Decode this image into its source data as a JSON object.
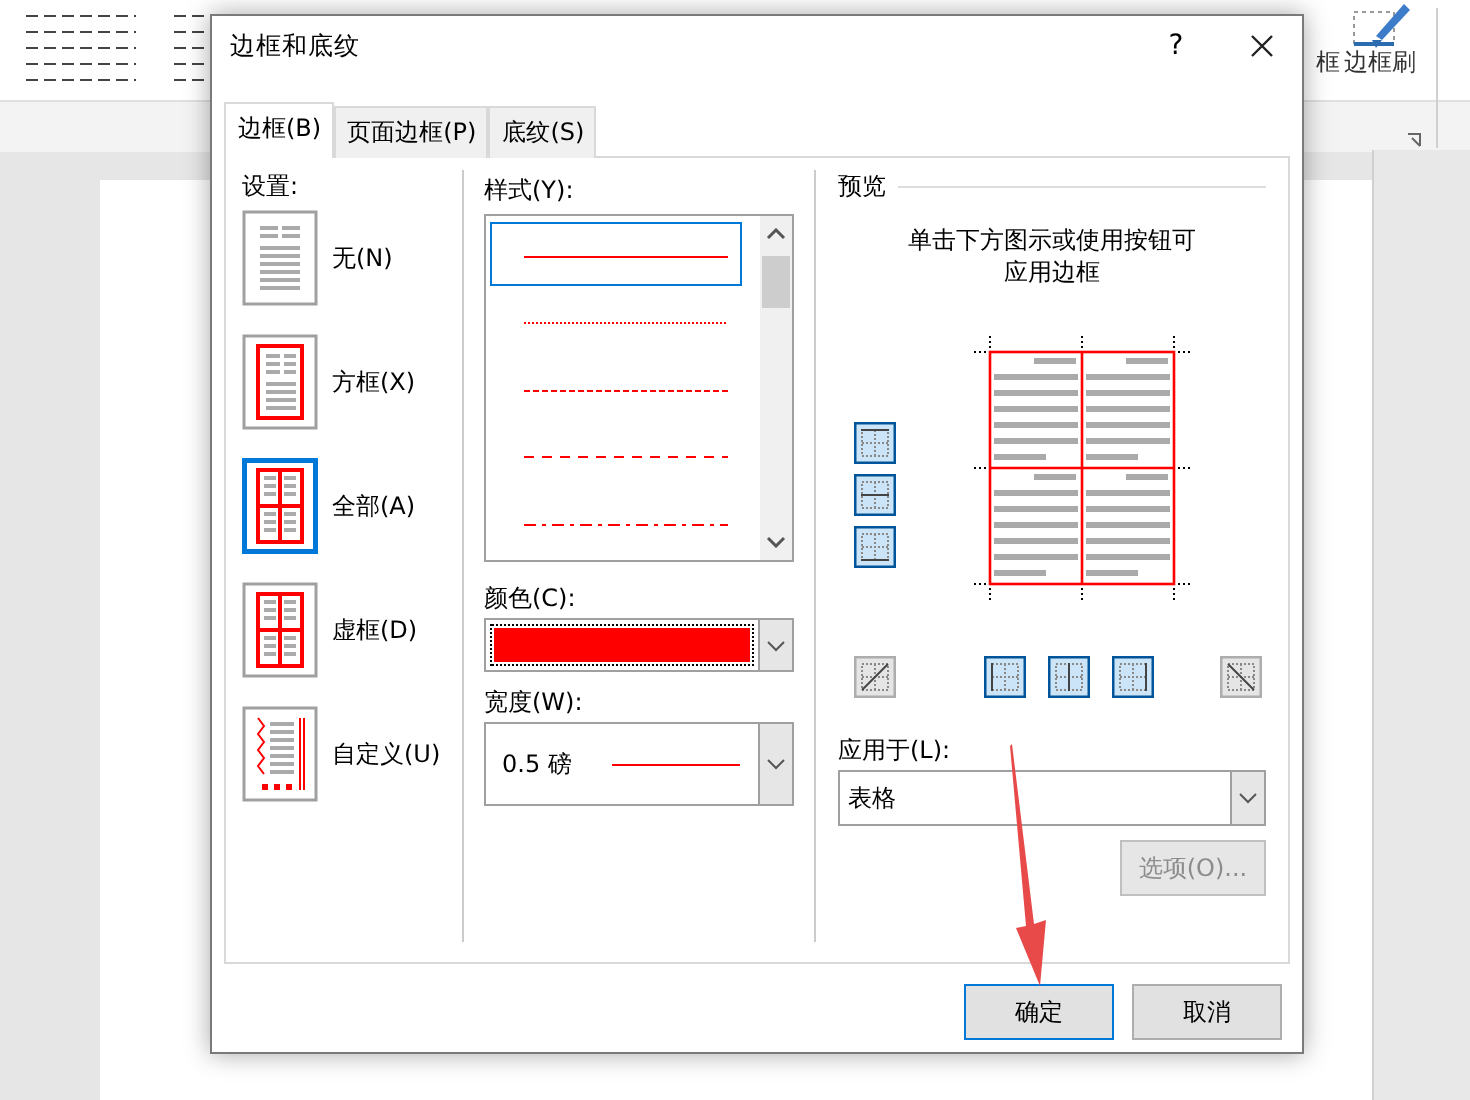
{
  "ribbon": {
    "labels": [
      {
        "text": "框"
      },
      {
        "text": "边框刷"
      }
    ]
  },
  "dialog": {
    "title": "边框和底纹",
    "help": "?"
  },
  "tabs": [
    {
      "label": "边框(B)",
      "selected": true
    },
    {
      "label": "页面边框(P)",
      "selected": false
    },
    {
      "label": "底纹(S)",
      "selected": false
    }
  ],
  "settings": {
    "label": "设置:",
    "items": [
      {
        "label": "无(N)",
        "kind": "none",
        "selected": false
      },
      {
        "label": "方框(X)",
        "kind": "box",
        "selected": false
      },
      {
        "label": "全部(A)",
        "kind": "all",
        "selected": true
      },
      {
        "label": "虚框(D)",
        "kind": "grid",
        "selected": false
      },
      {
        "label": "自定义(U)",
        "kind": "custom",
        "selected": false
      }
    ]
  },
  "style": {
    "label": "样式(Y):",
    "items": [
      {
        "kind": "solid",
        "selected": true
      },
      {
        "kind": "dotted",
        "selected": false
      },
      {
        "kind": "fine-dashed",
        "selected": false
      },
      {
        "kind": "dashed",
        "selected": false
      },
      {
        "kind": "dash-dot",
        "selected": false
      }
    ]
  },
  "color": {
    "label": "颜色(C):",
    "color": "#ff0000"
  },
  "width": {
    "label": "宽度(W):",
    "value": "0.5 磅"
  },
  "preview": {
    "label": "预览",
    "hint": "单击下方图示或使用按钮可应用边框",
    "side_buttons": [
      {
        "kind": "top",
        "on": true
      },
      {
        "kind": "middle-h",
        "on": true
      },
      {
        "kind": "bottom",
        "on": true
      }
    ],
    "bottom_buttons": [
      {
        "kind": "diag-up",
        "on": false
      },
      {
        "kind": "left",
        "on": true
      },
      {
        "kind": "middle-v",
        "on": true
      },
      {
        "kind": "right",
        "on": true
      },
      {
        "kind": "diag-down",
        "on": false
      }
    ]
  },
  "apply_to": {
    "label": "应用于(L):",
    "value": "表格"
  },
  "options_button": {
    "label": "选项(O)...",
    "disabled": true
  },
  "buttons": [
    {
      "label": "确定",
      "kind": "ok"
    },
    {
      "label": "取消",
      "kind": "cancel"
    }
  ]
}
